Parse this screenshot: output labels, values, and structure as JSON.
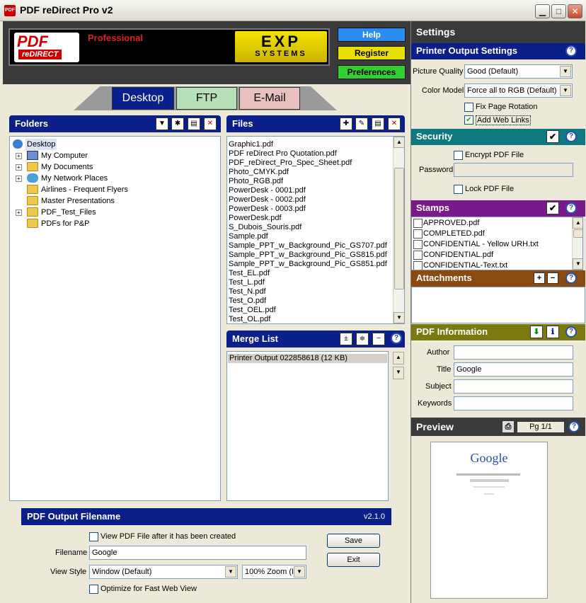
{
  "window": {
    "title": "PDF reDirect Pro v2",
    "icon_text": "PDF"
  },
  "logo": {
    "pdf": "PDF",
    "redirect": "reDIRECT",
    "edition": "Professional",
    "exp": "EXP",
    "systems": "SYSTEMS"
  },
  "header_buttons": {
    "help": "Help",
    "register": "Register",
    "preferences": "Preferences"
  },
  "tabs": [
    {
      "label": "Desktop"
    },
    {
      "label": "FTP"
    },
    {
      "label": "E-Mail"
    }
  ],
  "folders": {
    "title": "Folders",
    "items": [
      {
        "label": "Desktop"
      },
      {
        "label": "My Computer"
      },
      {
        "label": "My Documents"
      },
      {
        "label": "My Network Places"
      },
      {
        "label": "Airlines - Frequent Flyers"
      },
      {
        "label": "Master Presentations"
      },
      {
        "label": "PDF_Test_Files"
      },
      {
        "label": "PDFs for P&P"
      }
    ]
  },
  "files": {
    "title": "Files",
    "items": [
      "Graphic1.pdf",
      "PDF reDirect Pro Quotation.pdf",
      "PDF_reDirect_Pro_Spec_Sheet.pdf",
      "Photo_CMYK.pdf",
      "Photo_RGB.pdf",
      "PowerDesk - 0001.pdf",
      "PowerDesk - 0002.pdf",
      "PowerDesk - 0003.pdf",
      "PowerDesk.pdf",
      "S_Dubois_Souris.pdf",
      "Sample.pdf",
      "Sample_PPT_w_Background_Pic_GS707.pdf",
      "Sample_PPT_w_Background_Pic_GS815.pdf",
      "Sample_PPT_w_Background_Pic_GS851.pdf",
      "Test_EL.pdf",
      "Test_L.pdf",
      "Test_N.pdf",
      "Test_O.pdf",
      "Test_OEL.pdf",
      "Test_OL.pdf"
    ]
  },
  "merge": {
    "title": "Merge List",
    "items": [
      "Printer Output 022858618 (12 KB)"
    ]
  },
  "output": {
    "title": "PDF Output Filename",
    "version": "v2.1.0",
    "view_after_label": "View PDF File after it has been created",
    "filename_label": "Filename",
    "filename_value": "Google",
    "view_style_label": "View Style",
    "view_style_value": "Window (Default)",
    "zoom_value": "100% Zoom (I",
    "optimize_label": "Optimize for Fast Web View",
    "save": "Save",
    "exit": "Exit"
  },
  "settings": {
    "title": "Settings",
    "printer": {
      "title": "Printer Output Settings",
      "quality_label": "Picture Quality",
      "quality_value": "Good (Default)",
      "color_label": "Color Model",
      "color_value": "Force all  to RGB (Default)",
      "fix_rotation": "Fix Page Rotation",
      "web_links": "Add Web Links"
    },
    "security": {
      "title": "Security",
      "encrypt": "Encrypt PDF File",
      "password_label": "Password",
      "lock": "Lock PDF File"
    },
    "stamps": {
      "title": "Stamps",
      "items": [
        "APPROVED.pdf",
        "COMPLETED.pdf",
        "CONFIDENTIAL - Yellow URH.txt",
        "CONFIDENTIAL.pdf",
        "CONFIDENTIAL-Text.txt"
      ]
    },
    "attachments": {
      "title": "Attachments"
    },
    "info": {
      "title": "PDF Information",
      "author_label": "Author",
      "title_label": "Title",
      "title_value": "Google",
      "subject_label": "Subject",
      "keywords_label": "Keywords"
    },
    "preview": {
      "title": "Preview",
      "page": "Pg 1/1",
      "google": "Google"
    }
  },
  "colors": {
    "panel_blue": "#0a1f8a",
    "security_teal": "#0e7a80",
    "stamps_purple": "#7a1a8a",
    "attach_brown": "#8a4a10",
    "info_olive": "#7a7a10",
    "settings_dark": "#3a3a3a"
  }
}
